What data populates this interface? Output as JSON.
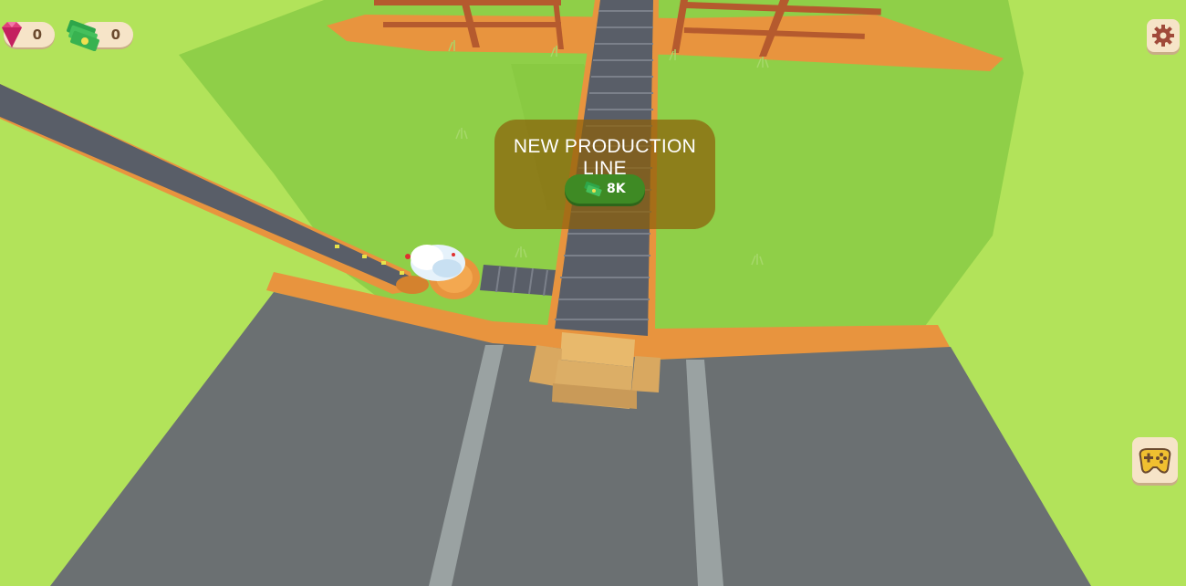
{
  "hud": {
    "gems": "0",
    "cash": "0"
  },
  "panel": {
    "title": "NEW PRODUCTION LINE",
    "price": "8K"
  },
  "icons": {
    "gem": "gem-icon",
    "cash": "cash-icon",
    "settings": "gear-icon",
    "games": "gamepad-icon"
  },
  "colors": {
    "grass": "#b2e35a",
    "grass_shade": "#8fcf48",
    "road": "#6b7072",
    "border": "#e8943e",
    "panel": "#8c5f0a",
    "price_button": "#3e8a24",
    "hud_pill": "#f6e4c8"
  }
}
